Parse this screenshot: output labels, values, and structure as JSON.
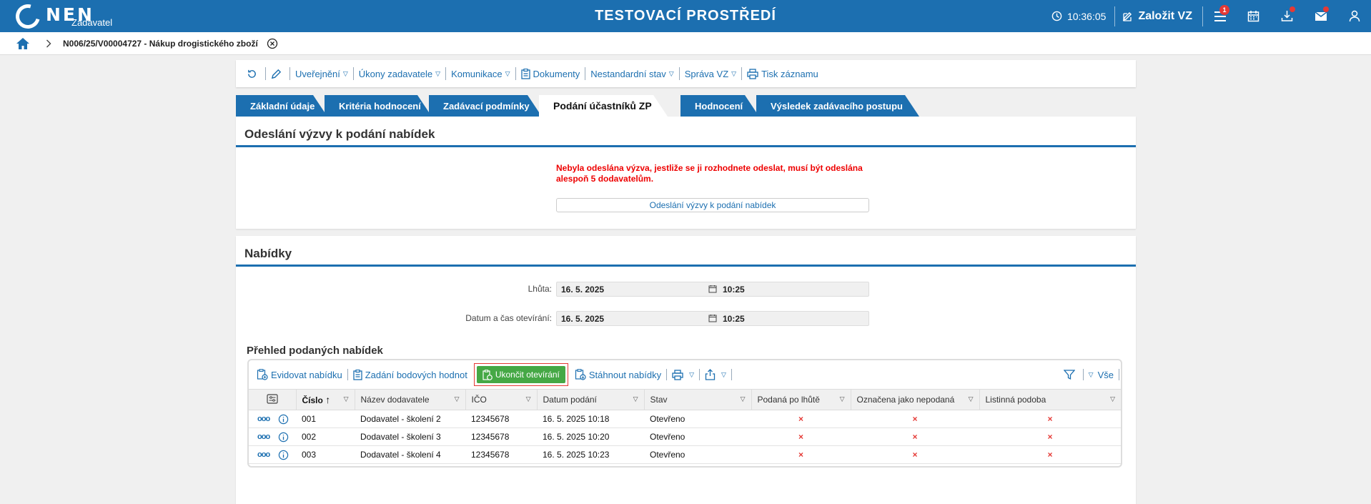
{
  "header": {
    "logo_text": "NEN",
    "logo_sub": "Zadavatel",
    "title": "TESTOVACÍ PROSTŘEDÍ",
    "time": "10:36:05",
    "create_label": "Založit VZ",
    "menu_badge": "1"
  },
  "breadcrumb": {
    "text": "N006/25/V00004727 - Nákup drogistického zboží"
  },
  "toolbar": {
    "publish": "Uveřejnění",
    "acts": "Úkony zadavatele",
    "comm": "Komunikace",
    "docs": "Dokumenty",
    "nonstd": "Nestandardní stav",
    "manage": "Správa VZ",
    "print": "Tisk záznamu"
  },
  "tabs": [
    "Základní údaje",
    "Kritéria hodnocení",
    "Zadávací podmínky",
    "Podání účastníků ZP",
    "Hodnocení",
    "Výsledek zadávacího postupu"
  ],
  "invite": {
    "title": "Odeslání výzvy k podání nabídek",
    "warning": "Nebyla odeslána výzva, jestliže se ji rozhodnete odeslat, musí být odeslána alespoň 5 dodavatelům.",
    "button": "Odeslání výzvy k podání nabídek"
  },
  "offers": {
    "title": "Nabídky",
    "deadline_label": "Lhůta:",
    "deadline_date": "16. 5. 2025",
    "deadline_time": "10:25",
    "open_label": "Datum a čas otevírání:",
    "open_date": "16. 5. 2025",
    "open_time": "10:25",
    "overview_title": "Přehled podaných nabídek"
  },
  "grid_toolbar": {
    "register": "Evidovat nabídku",
    "points": "Zadání bodových hodnot",
    "finish": "Ukončit otevírání",
    "download": "Stáhnout nabídky",
    "all": "Vše"
  },
  "columns": [
    "Číslo",
    "Název dodavatele",
    "IČO",
    "Datum podání",
    "Stav",
    "Podaná po lhůtě",
    "Označena jako nepodaná",
    "Listinná podoba"
  ],
  "rows": [
    {
      "num": "001",
      "name": "Dodavatel - školení 2",
      "ico": "12345678",
      "date": "16. 5. 2025 10:18",
      "state": "Otevřeno",
      "late": "×",
      "marked": "×",
      "paper": "×"
    },
    {
      "num": "002",
      "name": "Dodavatel - školení 3",
      "ico": "12345678",
      "date": "16. 5. 2025 10:20",
      "state": "Otevřeno",
      "late": "×",
      "marked": "×",
      "paper": "×"
    },
    {
      "num": "003",
      "name": "Dodavatel - školení 4",
      "ico": "12345678",
      "date": "16. 5. 2025 10:23",
      "state": "Otevřeno",
      "late": "×",
      "marked": "×",
      "paper": "×"
    }
  ],
  "colors": {
    "brand": "#1c6fb0",
    "danger": "#e53935",
    "success": "#45a845"
  }
}
